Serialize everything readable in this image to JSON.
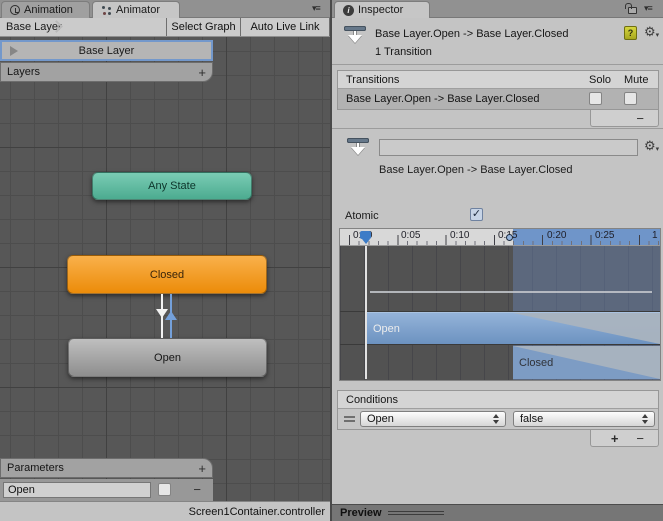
{
  "icons": {
    "menu": "▾≡",
    "gear": "⚙",
    "gear_caret": "▾",
    "info": "i",
    "check": "✓"
  },
  "colors": {
    "selection_blue": "#7398cb",
    "timeline_blue": "#6f95c9",
    "any_state_teal": "#5fbda2",
    "closed_orange": "#f09c1d",
    "open_gray": "#a8a8a8"
  },
  "animator": {
    "tabs": {
      "animation": "Animation",
      "animator": "Animator"
    },
    "toolbar": {
      "breadcrumb": "Base Layer",
      "select_graph": "Select Graph",
      "auto_live_link": "Auto Live Link"
    },
    "layers": {
      "selected": "Base Layer",
      "header": "Layers",
      "add": "+"
    },
    "nodes": {
      "any_state": "Any State",
      "closed": "Closed",
      "open": "Open"
    },
    "parameters": {
      "header": "Parameters",
      "add": "+",
      "name": "Open",
      "remove": "−"
    },
    "status": "Screen1Container.controller"
  },
  "inspector": {
    "tab": "Inspector",
    "header": {
      "title": "Base Layer.Open -> Base Layer.Closed",
      "subtitle": "1 Transition",
      "help": "?"
    },
    "transitions": {
      "header": "Transitions",
      "solo": "Solo",
      "mute": "Mute",
      "row": "Base Layer.Open -> Base Layer.Closed",
      "remove": "−"
    },
    "detail": {
      "name": "",
      "label": "Base Layer.Open -> Base Layer.Closed"
    },
    "atomic_label": "Atomic",
    "timeline": {
      "ticks": [
        "0:00",
        "0:05",
        "0:10",
        "0:15",
        "0:20",
        "0:25",
        "1"
      ],
      "open_track": "Open",
      "closed_track": "Closed"
    },
    "conditions": {
      "header": "Conditions",
      "parameter": "Open",
      "value": "false",
      "add": "+",
      "remove": "−"
    },
    "preview": "Preview"
  }
}
